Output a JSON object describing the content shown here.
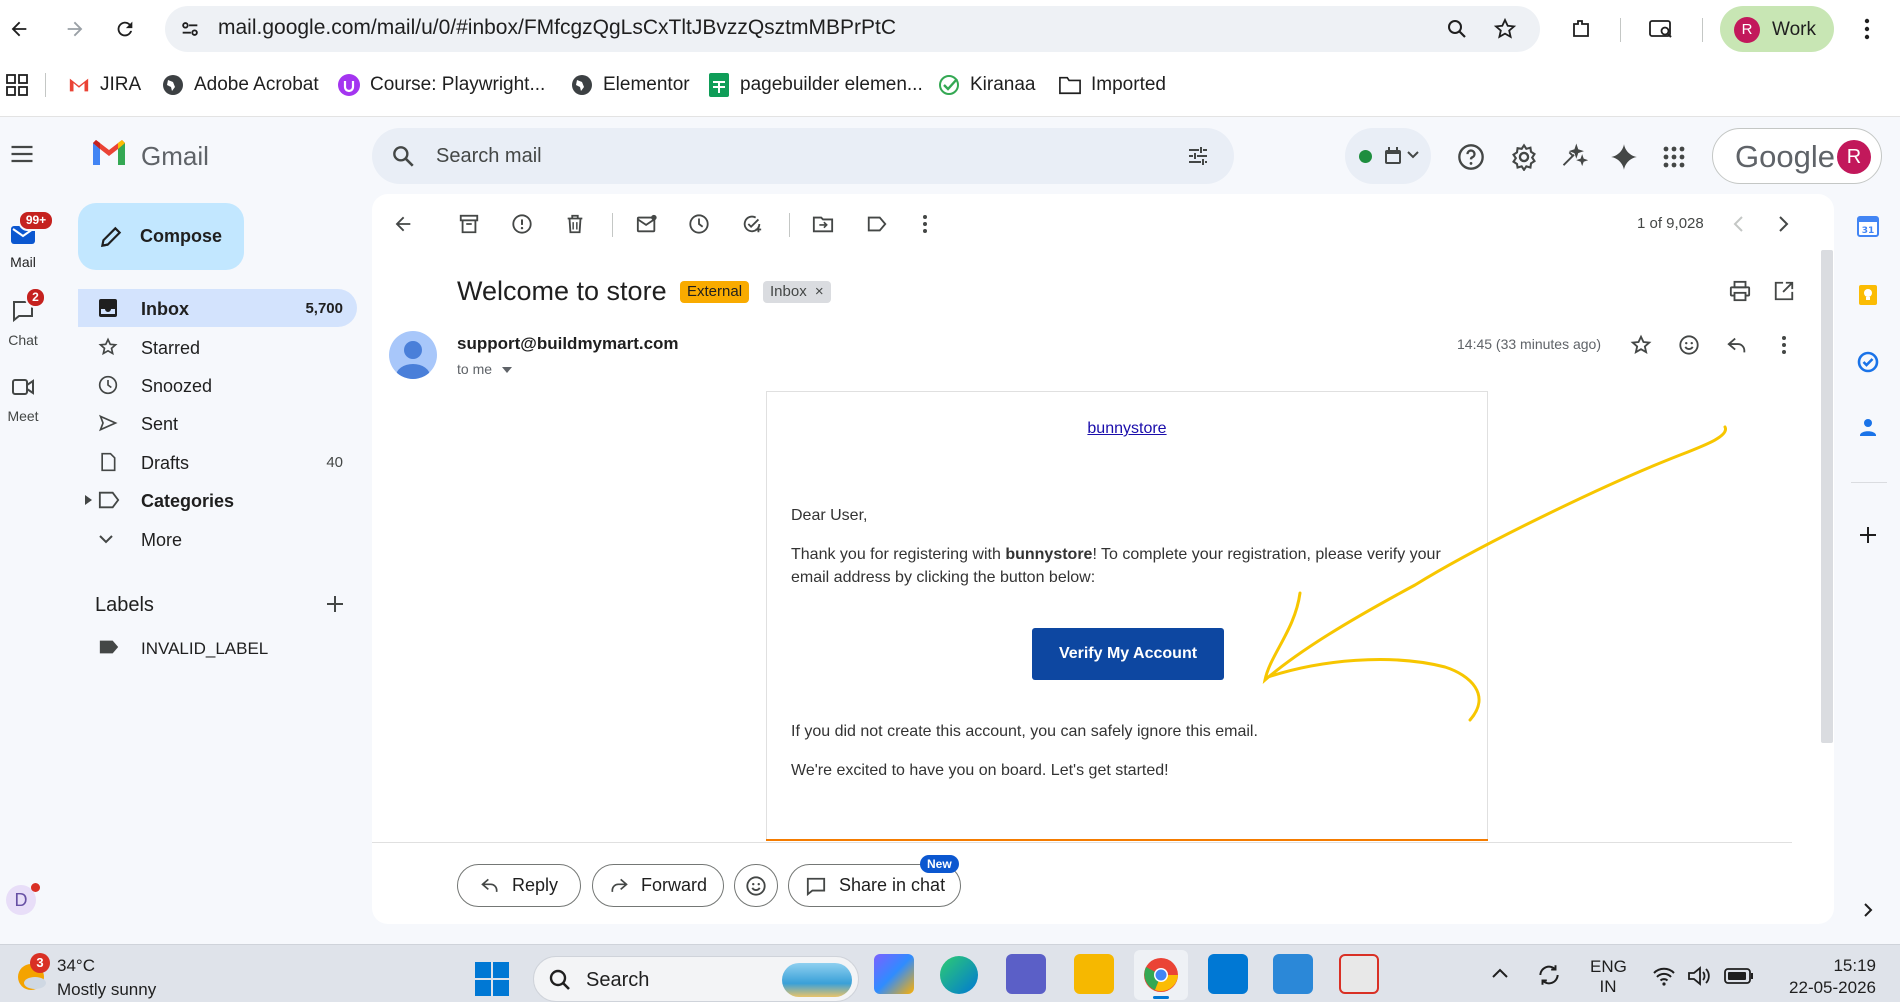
{
  "browser": {
    "url": "mail.google.com/mail/u/0/#inbox/FMfcgzQgLsCxTltJBvzzQsztmMBPrPtC",
    "profile_initial": "R",
    "profile_label": "Work"
  },
  "bookmarks": [
    {
      "label": "JIRA",
      "icon": "gmail-icon"
    },
    {
      "label": "Adobe Acrobat",
      "icon": "globe-icon"
    },
    {
      "label": "Course: Playwright...",
      "icon": "udemy-icon"
    },
    {
      "label": "Elementor",
      "icon": "globe-icon"
    },
    {
      "label": "pagebuilder elemen...",
      "icon": "sheets-icon"
    },
    {
      "label": "Kiranaa",
      "icon": "check-icon"
    },
    {
      "label": "Imported",
      "icon": "folder-icon"
    }
  ],
  "gmail": {
    "app_title": "Gmail",
    "search_placeholder": "Search mail",
    "google_label": "Google",
    "avatar_initial": "R"
  },
  "rail": {
    "mail_label": "Mail",
    "mail_badge": "99+",
    "chat_label": "Chat",
    "chat_badge": "2",
    "meet_label": "Meet",
    "bottom_avatar": "D"
  },
  "sidebar": {
    "compose_label": "Compose",
    "items": [
      {
        "label": "Inbox",
        "count": "5,700",
        "icon": "inbox-icon"
      },
      {
        "label": "Starred",
        "count": "",
        "icon": "star-icon"
      },
      {
        "label": "Snoozed",
        "count": "",
        "icon": "clock-icon"
      },
      {
        "label": "Sent",
        "count": "",
        "icon": "send-icon"
      },
      {
        "label": "Drafts",
        "count": "40",
        "icon": "draft-icon"
      },
      {
        "label": "Categories",
        "count": "",
        "icon": "label-icon"
      },
      {
        "label": "More",
        "count": "",
        "icon": "chevron-down-icon"
      }
    ],
    "labels_heading": "Labels",
    "labels": [
      {
        "label": "INVALID_LABEL"
      }
    ]
  },
  "toolbar": {
    "pagination": "1 of 9,028"
  },
  "email": {
    "subject": "Welcome to store",
    "tag_external": "External",
    "tag_inbox": "Inbox",
    "tag_close": "×",
    "sender": "support@buildmymart.com",
    "recipient": "to me",
    "time": "14:45 (33 minutes ago)",
    "body": {
      "brand_link": "bunnystore",
      "greeting": "Dear User,",
      "para1_before": "Thank you for registering with ",
      "para1_bold": "bunnystore",
      "para1_after": "! To complete your registration, please verify your email address by clicking the button below:",
      "verify_button": "Verify My Account",
      "para2": "If you did not create this account, you can safely ignore this email.",
      "para3": "We're excited to have you on board. Let's get started!"
    }
  },
  "reply_actions": {
    "reply": "Reply",
    "forward": "Forward",
    "share": "Share in chat",
    "new_badge": "New"
  },
  "taskbar": {
    "weather_temp": "34°C",
    "weather_desc": "Mostly sunny",
    "weather_badge": "3",
    "search_label": "Search",
    "lang_top": "ENG",
    "lang_bottom": "IN",
    "clock_time": "15:19",
    "clock_date": "22-05-2026"
  },
  "colors": {
    "accent_blue": "#0b57d0",
    "verify_button": "#0d47a1",
    "external_tag": "#f9ab00",
    "annotation_arrow": "#f7c600",
    "inbox_active": "#d3e3fd"
  }
}
